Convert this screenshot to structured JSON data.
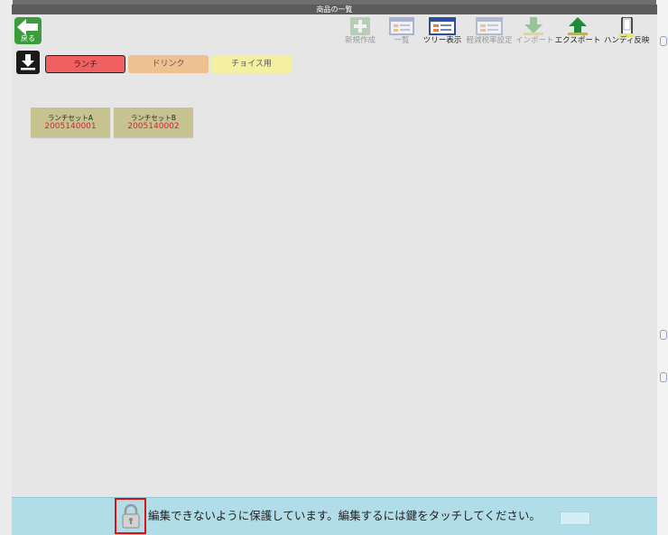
{
  "window": {
    "title": "商品の一覧"
  },
  "toolbar": {
    "back_label": "戻る",
    "new_label": "新規作成",
    "list_label": "一覧",
    "tree_label": "ツリー表示",
    "bulk_edit_label": "軽減税率設定",
    "import_label": "インポート",
    "export_label": "エクスポート",
    "handy_label": "ハンディ反映"
  },
  "tabs": [
    {
      "label": "ランチ",
      "selected": true,
      "color": "#f06060"
    },
    {
      "label": "ドリンク",
      "selected": false,
      "color": "#efc090"
    },
    {
      "label": "チョイス用",
      "selected": false,
      "color": "#f3f0a2"
    }
  ],
  "items": [
    {
      "name": "ランチセットA",
      "code": "2005140001"
    },
    {
      "name": "ランチセットB",
      "code": "2005140002"
    }
  ],
  "lock_bar": {
    "message": "編集できないように保護しています。編集するには鍵をタッチしてください。",
    "background": "#b1dde9"
  },
  "colors": {
    "accent_green": "#3c9b3c",
    "code_red": "#d3243a"
  }
}
